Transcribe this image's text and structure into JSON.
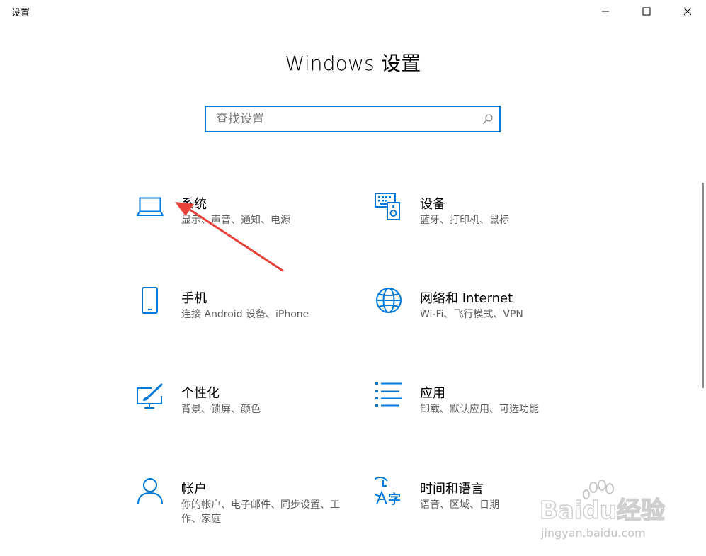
{
  "window": {
    "title": "设置",
    "controls": [
      "minimize",
      "maximize",
      "close"
    ]
  },
  "header": {
    "title": "Windows 设置"
  },
  "search": {
    "placeholder": "查找设置",
    "value": ""
  },
  "tiles": [
    {
      "id": "system",
      "icon": "laptop-icon",
      "name": "系统",
      "desc": "显示、声音、通知、电源"
    },
    {
      "id": "devices",
      "icon": "keyboard-speaker-icon",
      "name": "设备",
      "desc": "蓝牙、打印机、鼠标"
    },
    {
      "id": "phone",
      "icon": "phone-icon",
      "name": "手机",
      "desc": "连接 Android 设备、iPhone"
    },
    {
      "id": "network",
      "icon": "globe-icon",
      "name": "网络和 Internet",
      "desc": "Wi-Fi、飞行模式、VPN"
    },
    {
      "id": "personalization",
      "icon": "paint-brush-icon",
      "name": "个性化",
      "desc": "背景、锁屏、颜色"
    },
    {
      "id": "apps",
      "icon": "app-list-icon",
      "name": "应用",
      "desc": "卸载、默认应用、可选功能"
    },
    {
      "id": "accounts",
      "icon": "person-icon",
      "name": "帐户",
      "desc": "你的帐户、电子邮件、同步设置、工作、家庭"
    },
    {
      "id": "time-language",
      "icon": "time-language-icon",
      "name": "时间和语言",
      "desc": "语音、区域、日期"
    }
  ],
  "colors": {
    "accent": "#0078d7",
    "annotation_arrow": "#e8413a"
  },
  "watermark": {
    "brand": "Baidu经验",
    "url": "jingyan.baidu.com"
  }
}
